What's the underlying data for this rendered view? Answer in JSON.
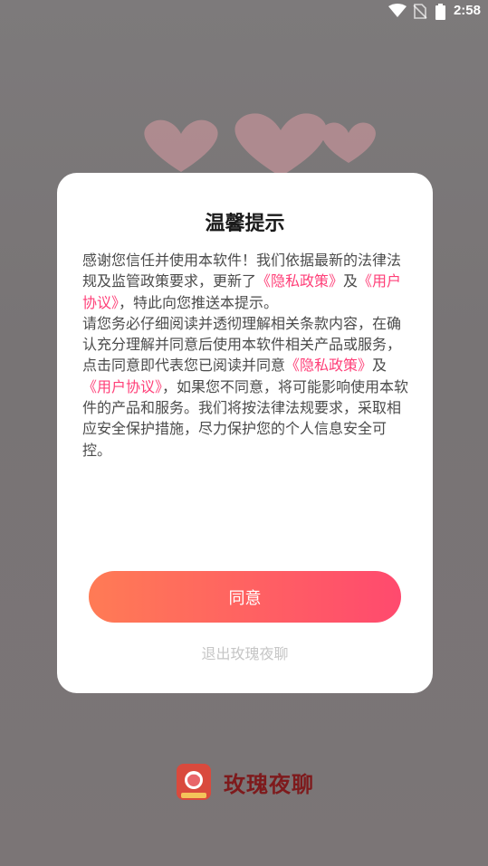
{
  "status_bar": {
    "time": "2:58",
    "icons": [
      "wifi-icon",
      "no-sim-icon",
      "battery-icon"
    ]
  },
  "dialog": {
    "title": "温馨提示",
    "body": {
      "p1_prefix": "感谢您信任并使用本软件！我们依据最新的法律法规及监管政策要求，更新了",
      "privacy_link_1": "《隐私政策》",
      "p1_and": "及",
      "user_agreement_link_1": "《用户协议》",
      "p1_suffix": "，特此向您推送本提示。",
      "p2_prefix": "请您务必仔细阅读并透彻理解相关条款内容，在确认充分理解并同意后使用本软件相关产品或服务，点击同意即代表您已阅读并同意",
      "privacy_link_2": "《隐私政策》",
      "p2_and": "及",
      "user_agreement_link_2": "《用户协议》",
      "p2_suffix": "，如果您不同意，将可能影响使用本软件的产品和服务。我们将按法律法规要求，采取相应安全保护措施，尽力保护您的个人信息安全可控。"
    },
    "agree_label": "同意",
    "exit_label": "退出玫瑰夜聊"
  },
  "brand": {
    "name": "玫瑰夜聊",
    "logo_icon": "rose-chat-logo-icon"
  },
  "colors": {
    "link": "#ff3f78",
    "button_gradient_start": "#ff7b55",
    "button_gradient_end": "#ff4a6e",
    "brand_text": "#7e1a1c"
  }
}
